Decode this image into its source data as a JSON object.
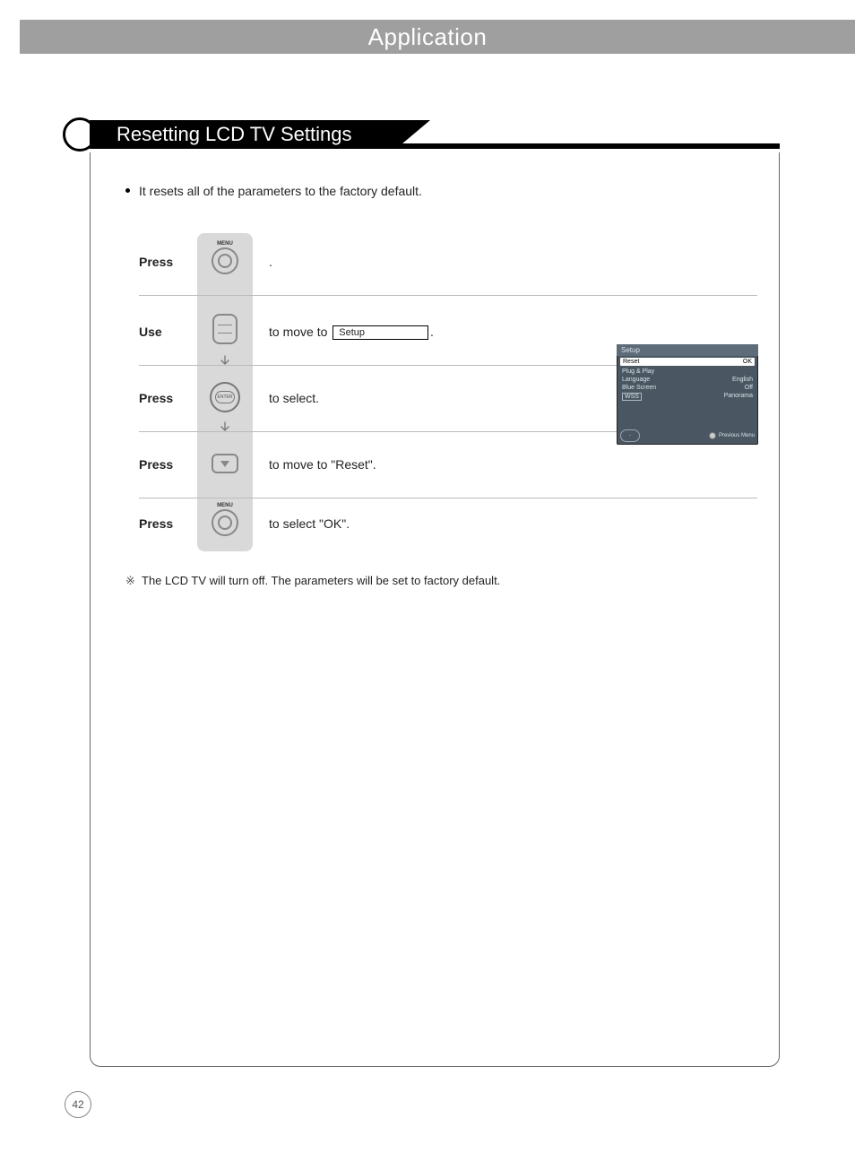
{
  "header": {
    "title": "Application"
  },
  "section": {
    "title": "Resetting LCD TV Settings"
  },
  "intro": "It resets all of the parameters to the factory default.",
  "steps": [
    {
      "verb": "Press",
      "button": "menu",
      "desc_after": "."
    },
    {
      "verb": "Use",
      "button": "nav",
      "desc_before": "to move to ",
      "box": "Setup",
      "desc_after": "."
    },
    {
      "verb": "Press",
      "button": "enter",
      "desc_after": "to select."
    },
    {
      "verb": "Press",
      "button": "down",
      "desc_after": "to move to  \"Reset\"."
    },
    {
      "verb": "Press",
      "button": "menu",
      "desc_after": "to select  \"OK\"."
    }
  ],
  "button_labels": {
    "menu": "MENU",
    "enter": "ENTER"
  },
  "note": "The LCD TV will turn off. The parameters will be set to factory default.",
  "osd": {
    "title": "Setup",
    "reset_row": {
      "label": "Reset",
      "value": "OK"
    },
    "items": [
      {
        "label": "Plug & Play",
        "value": ""
      },
      {
        "label": "Language",
        "value": "English"
      },
      {
        "label": "Blue Screen",
        "value": "Off"
      },
      {
        "label": "WSS",
        "value": "Panorama"
      }
    ],
    "footer_hint": "Previous Menu"
  },
  "page_number": "42"
}
